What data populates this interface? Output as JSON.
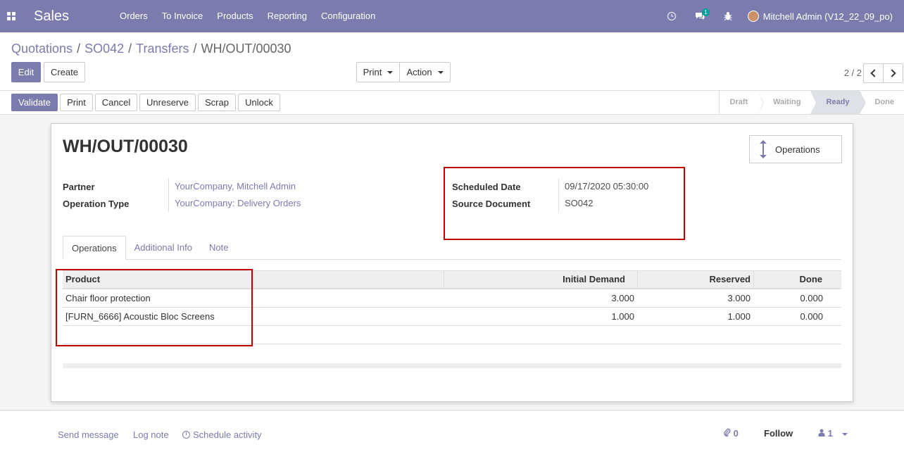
{
  "nav": {
    "app_name": "Sales",
    "menu": [
      "Orders",
      "To Invoice",
      "Products",
      "Reporting",
      "Configuration"
    ],
    "messages_badge": "1",
    "user_name": "Mitchell Admin (V12_22_09_po)"
  },
  "breadcrumb": {
    "items": [
      "Quotations",
      "SO042",
      "Transfers"
    ],
    "current": "WH/OUT/00030"
  },
  "control": {
    "edit_label": "Edit",
    "create_label": "Create",
    "print_label": "Print",
    "action_label": "Action",
    "pager": "2 / 2"
  },
  "statusbar": {
    "buttons": [
      "Validate",
      "Print",
      "Cancel",
      "Unreserve",
      "Scrap",
      "Unlock"
    ],
    "stages": [
      "Draft",
      "Waiting",
      "Ready",
      "Done"
    ],
    "current_stage": "Ready"
  },
  "record": {
    "title": "WH/OUT/00030",
    "smart_button": "Operations",
    "partner_label": "Partner",
    "partner_value": "YourCompany, Mitchell Admin",
    "operation_type_label": "Operation Type",
    "operation_type_value": "YourCompany: Delivery Orders",
    "scheduled_date_label": "Scheduled Date",
    "scheduled_date_value": "09/17/2020 05:30:00",
    "source_document_label": "Source Document",
    "source_document_value": "SO042"
  },
  "tabs": [
    "Operations",
    "Additional Info",
    "Note"
  ],
  "table": {
    "headers": [
      "Product",
      "Initial Demand",
      "Reserved",
      "Done"
    ],
    "rows": [
      [
        "Chair floor protection",
        "3.000",
        "3.000",
        "0.000"
      ],
      [
        "[FURN_6666] Acoustic Bloc Screens",
        "1.000",
        "1.000",
        "0.000"
      ]
    ]
  },
  "chatter": {
    "send_message": "Send message",
    "log_note": "Log note",
    "schedule_activity": "Schedule activity",
    "attachments": "0",
    "follow": "Follow",
    "followers": "1"
  },
  "colors": {
    "brand": "#7c7bad",
    "highlight": "#c00000"
  }
}
